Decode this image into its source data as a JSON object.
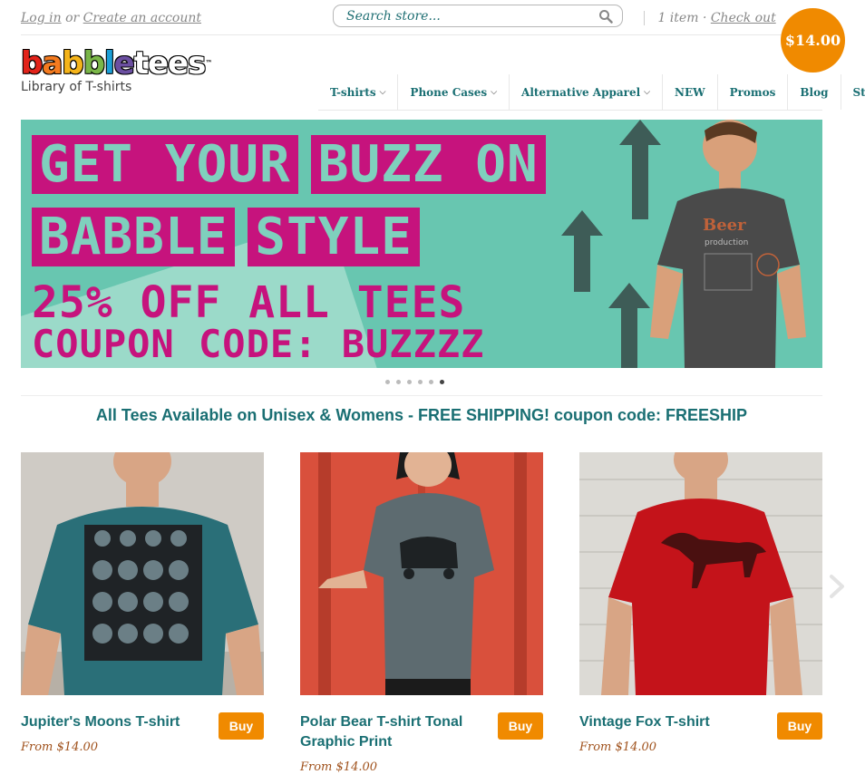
{
  "header": {
    "login_label": "Log in",
    "or_text": "or",
    "create_account_label": "Create an account",
    "search_placeholder": "Search store...",
    "cart_items": "1 item",
    "cart_sep": "·",
    "checkout_label": "Check out",
    "cart_total": "$14.00"
  },
  "logo": {
    "word_letters": [
      "b",
      "a",
      "b",
      "b",
      "l",
      "e",
      "t",
      "e",
      "e",
      "s"
    ],
    "letter_colors": [
      "#e2231a",
      "#f47b20",
      "#f5b41a",
      "#7ab648",
      "#1ba0d8",
      "#6b4fa1",
      "#ffffff",
      "#ffffff",
      "#ffffff",
      "#ffffff"
    ],
    "trademark": "™",
    "tagline": "Library of T-shirts"
  },
  "nav": {
    "items": [
      {
        "label": "T-shirts",
        "chevron": "⌵"
      },
      {
        "label": "Phone Cases",
        "chevron": "⌵"
      },
      {
        "label": "Alternative Apparel",
        "chevron": "⌵"
      },
      {
        "label": "NEW",
        "chevron": ""
      },
      {
        "label": "Promos",
        "chevron": ""
      },
      {
        "label": "Blog",
        "chevron": ""
      },
      {
        "label": "Style",
        "chevron": ""
      }
    ]
  },
  "banner": {
    "line1_a": "GET YOUR",
    "line1_b": "BUZZ ON",
    "line2_a": "BABBLE",
    "line2_b": "STYLE",
    "line3": "25% OFF ALL TEES",
    "line4": "COUPON CODE: BUZZZZ",
    "shirt_text_1": "Beer",
    "shirt_text_2": "production",
    "slide_count": 6,
    "active_slide": 6
  },
  "promo": {
    "text": "All Tees Available on Unisex & Womens - FREE SHIPPING! coupon code: FREESHIP"
  },
  "products": [
    {
      "name": "Jupiter's Moons T-shirt",
      "price": "From $14.00",
      "buy_label": "Buy"
    },
    {
      "name": "Polar Bear T-shirt Tonal Graphic Print",
      "price": "From $14.00",
      "buy_label": "Buy"
    },
    {
      "name": "Vintage Fox T-shirt",
      "price": "From $14.00",
      "buy_label": "Buy"
    }
  ],
  "colors": {
    "brand_teal": "#1a6f73",
    "accent_orange": "#f08a00",
    "banner_pink": "#c6137d",
    "banner_teal": "#68c6b0"
  },
  "icons": {
    "search": "magnifier-icon",
    "next": "chevron-right-icon"
  }
}
